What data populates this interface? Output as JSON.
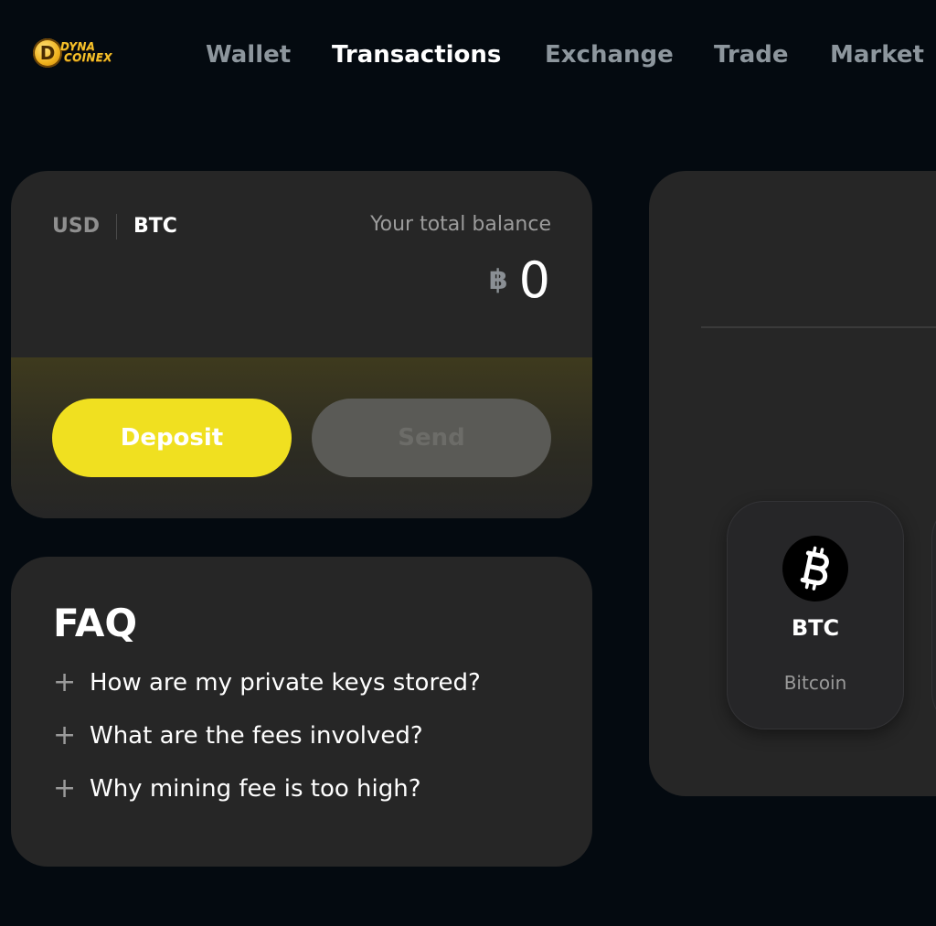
{
  "logo": {
    "line1": "DYNA",
    "line2": "COINEX",
    "coin_glyph": "D"
  },
  "nav": {
    "items": [
      {
        "label": "Wallet",
        "active": false
      },
      {
        "label": "Transactions",
        "active": true
      },
      {
        "label": "Exchange",
        "active": false
      },
      {
        "label": "Trade",
        "active": false
      },
      {
        "label": "Market",
        "active": false
      }
    ]
  },
  "balance": {
    "currency_usd": "USD",
    "currency_btc": "BTC",
    "selected_currency": "BTC",
    "label": "Your total balance",
    "symbol": "฿",
    "value": "0",
    "deposit_label": "Deposit",
    "send_label": "Send",
    "send_disabled": true
  },
  "faq": {
    "title": "FAQ",
    "items": [
      {
        "plus": "+",
        "question": "How are my private keys stored?"
      },
      {
        "plus": "+",
        "question": "What are the fees involved?"
      },
      {
        "plus": "+",
        "question": "Why mining fee is too high?"
      }
    ]
  },
  "coins": [
    {
      "symbol": "BTC",
      "name": "Bitcoin",
      "icon": "bitcoin-icon"
    }
  ],
  "colors": {
    "background": "#040a10",
    "card": "#262626",
    "accent_yellow": "#f0e020",
    "logo_gold": "#f6c22a",
    "nav_inactive": "#8d969d"
  }
}
